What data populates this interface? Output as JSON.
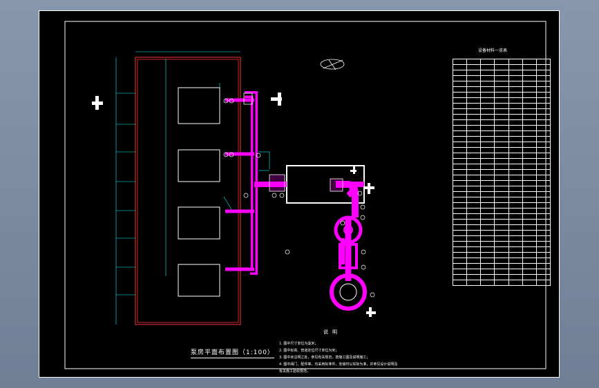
{
  "drawing": {
    "plan_title": "泵房平面布置图（1:100）",
    "notes_heading": "说明",
    "notes": [
      "1. 图中尺寸单位为毫米；",
      "2. 图中标高、管道定位尺寸单位为米；",
      "3. 图中未注明之处，参见有关规范，按施工图及说明施工；",
      "4. 图中阀门、配件等，均采用标准件，安装时以实际为准，并参见设计说明及",
      "   有关施工验收规范。"
    ],
    "table_title": "设备材料一览表",
    "table_rows": 41
  },
  "colors": {
    "sheet": "#000000",
    "line": "#ffffff",
    "pipe": "#ff00ff",
    "dimension": "#00ffff",
    "wall": "#ff3333",
    "background": "#7f8fa6"
  }
}
